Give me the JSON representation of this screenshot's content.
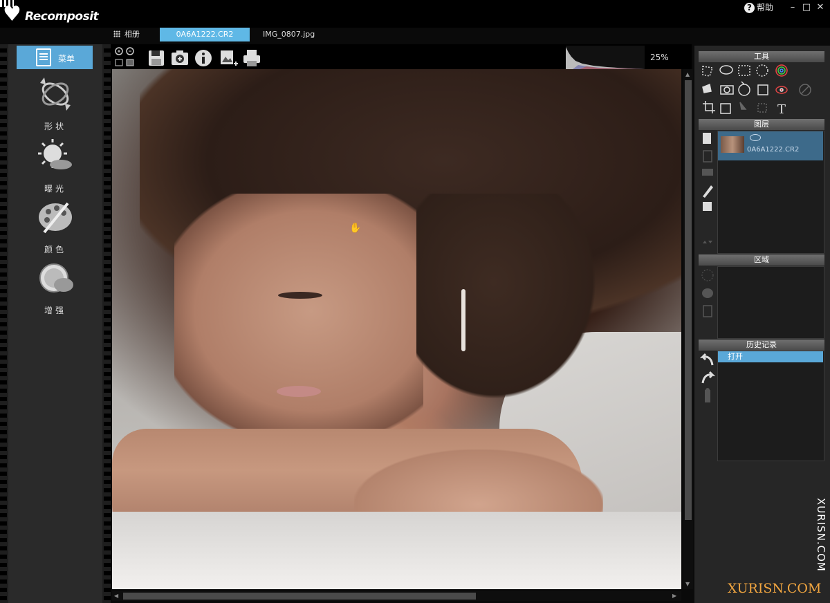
{
  "app": {
    "brand": "Recomposit",
    "help_label": "帮助",
    "minimize": "–",
    "maximize": "□",
    "close": "✕"
  },
  "tabs": {
    "album": "相册",
    "active": "0A6A1222.CR2",
    "other": "IMG_0807.jpg"
  },
  "sidebar": {
    "menu": "菜单",
    "tools": [
      {
        "label": "形状",
        "icon": "shape-icon"
      },
      {
        "label": "曝光",
        "icon": "exposure-icon"
      },
      {
        "label": "颜色",
        "icon": "color-palette-icon"
      },
      {
        "label": "增强",
        "icon": "enhance-icon"
      }
    ]
  },
  "toolbar": {
    "zoom": "25%",
    "icons": [
      "zoom-in-icon",
      "zoom-out-icon",
      "fit-icon",
      "actual-size-icon",
      "save-icon",
      "export-icon",
      "info-icon",
      "add-image-icon",
      "print-icon"
    ]
  },
  "right": {
    "tools_header": "工具",
    "layers_header": "图层",
    "layer_name": "0A6A1222.CR2",
    "regions_header": "区域",
    "history_header": "历史记录",
    "history_items": [
      "打开"
    ]
  },
  "watermark": {
    "vertical": "XURISN.COM",
    "horizontal": "XURISN.COM"
  },
  "colors": {
    "accent": "#5aa8d8",
    "tab_active": "#5fb8e6",
    "watermark": "#f2a640"
  }
}
